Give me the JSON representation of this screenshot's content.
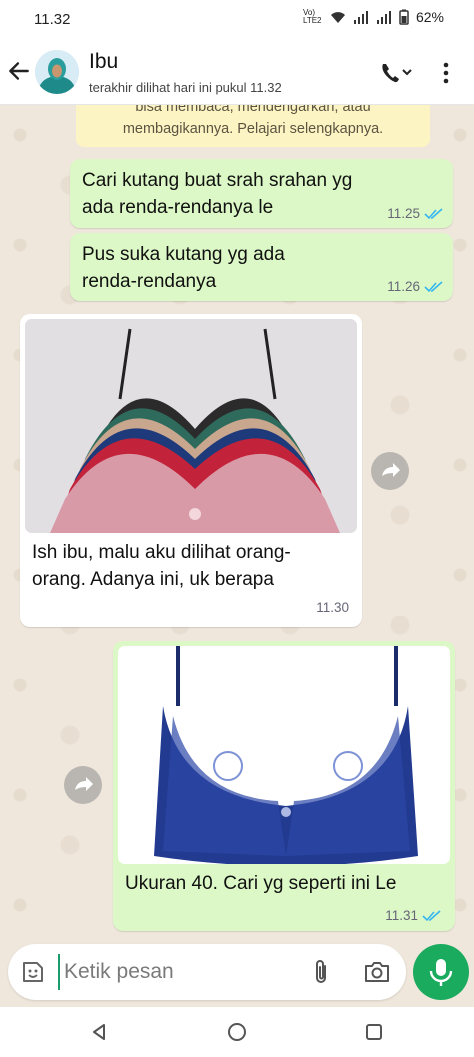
{
  "status_bar": {
    "time": "11.32",
    "network": "Vo) LTE2",
    "battery": "62%"
  },
  "header": {
    "contact_name": "Ibu",
    "last_seen": "terakhir dilihat hari ini pukul 11.32",
    "icons": [
      "back-arrow-icon",
      "avatar",
      "phone-call-icon",
      "more-vertical-icon"
    ]
  },
  "notice": {
    "line1": "bisa membaca, mendengarkan, atau",
    "line2": "membagikannya. Pelajari selengkapnya."
  },
  "messages": [
    {
      "direction": "out",
      "text": "Cari kutang buat srah srahan yg ada renda-rendanya le",
      "time": "11.25",
      "status": "read"
    },
    {
      "direction": "out",
      "text": "Pus suka kutang yg ada renda-rendanya",
      "time": "11.26",
      "status": "read"
    },
    {
      "direction": "in",
      "text": "Ish ibu, malu aku dilihat orang-orang. Adanya ini, uk berapa",
      "time": "11.30",
      "image": "stack of colorful bras"
    },
    {
      "direction": "out",
      "text": "Ukuran 40. Cari yg seperti ini Le",
      "time": "11.31",
      "status": "read",
      "image": "navy lace bra"
    }
  ],
  "input": {
    "placeholder": "Ketik pesan"
  },
  "colors": {
    "outgoing_bubble": "#dcf8c6",
    "incoming_bubble": "#ffffff",
    "read_ticks": "#34b7f1",
    "mic_button": "#1aab5f",
    "chat_background": "#efe7dc"
  }
}
